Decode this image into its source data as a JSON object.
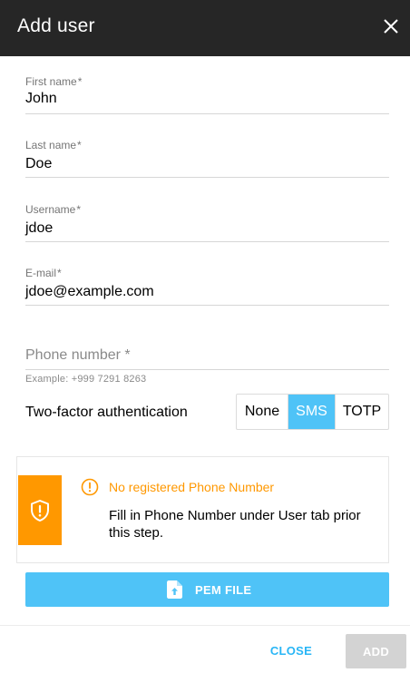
{
  "dialog": {
    "title": "Add user"
  },
  "form": {
    "required_marker": "*",
    "first_name": {
      "label": "First name",
      "value": "John"
    },
    "last_name": {
      "label": "Last name",
      "value": "Doe"
    },
    "username": {
      "label": "Username",
      "value": "jdoe"
    },
    "email": {
      "label": "E-mail",
      "value": "jdoe@example.com"
    },
    "phone": {
      "placeholder": "Phone number",
      "value": "",
      "hint": "Example: +999 7291 8263"
    }
  },
  "two_factor": {
    "label": "Two-factor authentication",
    "options": [
      "None",
      "SMS",
      "TOTP"
    ],
    "selected": "SMS"
  },
  "alert": {
    "title": "No registered Phone Number",
    "message": "Fill in Phone Number under User tab prior this step.",
    "icon": "shield-alert-icon",
    "color": "#ff9800"
  },
  "pem_button": {
    "label": "PEM FILE",
    "icon": "file-upload-icon"
  },
  "footer": {
    "close_label": "CLOSE",
    "add_label": "ADD"
  },
  "colors": {
    "header_bg": "#262626",
    "accent": "#4fc3f7",
    "link": "#29b6f6",
    "warning": "#ff9800",
    "disabled": "#d3d3d3"
  }
}
